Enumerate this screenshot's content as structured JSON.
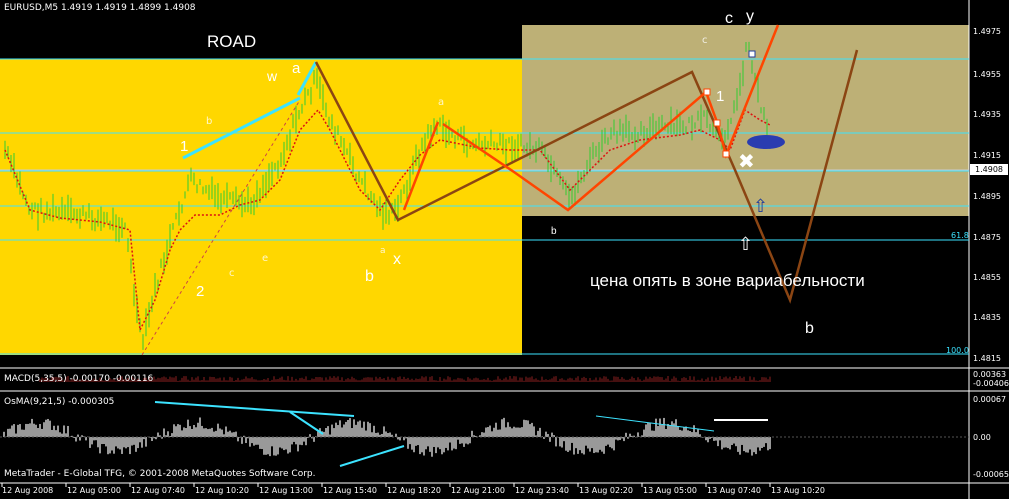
{
  "main_chart": {
    "header": "EURUSD,M5  1.4919 1.4919 1.4899 1.4908",
    "y_ticks": [
      "1.4975",
      "1.4955",
      "1.4935",
      "1.4915",
      "1.4895",
      "1.4875",
      "1.4855",
      "1.4835",
      "1.4815"
    ],
    "current_price": "1.4908",
    "zone_left_label": "ROAD",
    "annotation_text": "цена опять в зоне вариабельности",
    "fib_levels": [
      "61.8",
      "100.0"
    ],
    "wave_labels": {
      "w": "w",
      "a_top": "a",
      "one_left": "1",
      "two": "2",
      "b_left": "b",
      "x_left": "x",
      "c": "c",
      "y": "y",
      "one_right": "1",
      "b_bottom": "b",
      "b_mid": "b"
    },
    "faint_labels": [
      "b",
      "a",
      "c",
      "e",
      "a",
      "c"
    ],
    "colors": {
      "yellow_zone": "#FFD700",
      "khaki_zone": "#BDB076",
      "cyan": "#3CE3FF",
      "brown": "#8B4513",
      "orange_red": "#FF4500",
      "green_bars": "#32CD32"
    }
  },
  "macd_panel": {
    "label": "MACD(5,35,5) -0.00170 -0.00116",
    "y_ticks": [
      "0.00363",
      "-0.00406"
    ]
  },
  "osma_panel": {
    "label": "OsMA(9,21,5) -0.000305",
    "y_ticks": [
      "0.00067",
      "0.00",
      "-0.00065"
    ],
    "copyright": "MetaTrader - E-Global TFG, © 2001-2008 MetaQuotes Software Corp."
  },
  "time_axis": {
    "labels": [
      "12 Aug 2008",
      "12 Aug 05:00",
      "12 Aug 07:40",
      "12 Aug 10:20",
      "12 Aug 13:00",
      "12 Aug 15:40",
      "12 Aug 18:20",
      "12 Aug 21:00",
      "12 Aug 23:40",
      "13 Aug 02:20",
      "13 Aug 05:00",
      "13 Aug 07:40",
      "13 Aug 10:20"
    ]
  }
}
